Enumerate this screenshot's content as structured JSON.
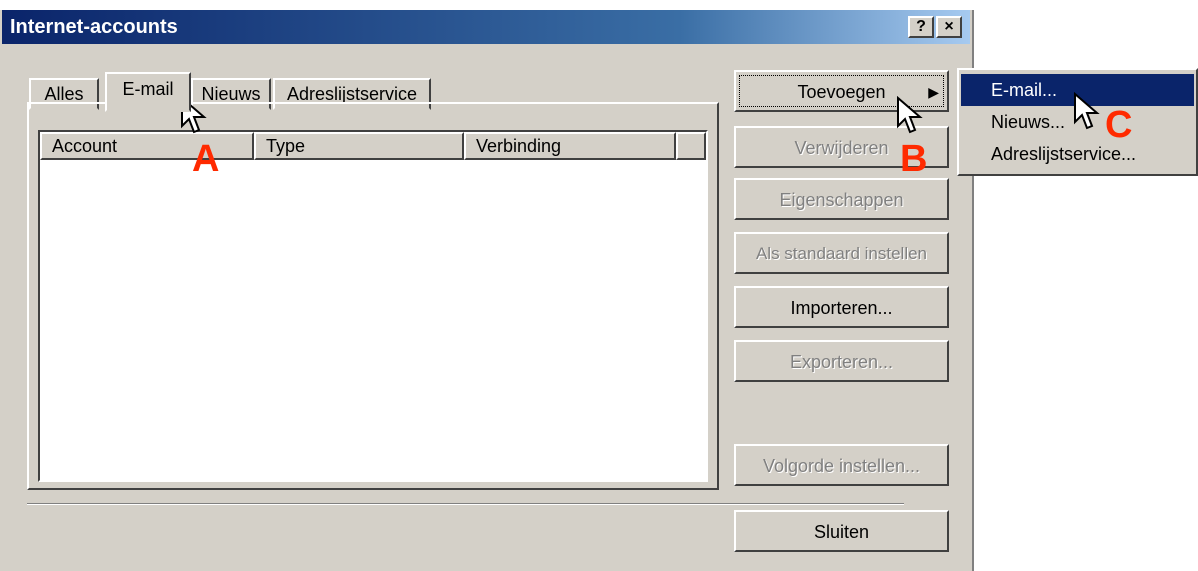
{
  "window": {
    "title": "Internet-accounts",
    "help_btn": "?",
    "close_btn": "×"
  },
  "tabs": [
    {
      "label": "Alles"
    },
    {
      "label": "E-mail"
    },
    {
      "label": "Nieuws"
    },
    {
      "label": "Adreslijstservice"
    }
  ],
  "list": {
    "columns": [
      "Account",
      "Type",
      "Verbinding"
    ],
    "rows": []
  },
  "buttons": {
    "toevoegen": "Toevoegen",
    "toevoegen_arrow": "▶",
    "verwijderen": "Verwijderen",
    "eigenschappen": "Eigenschappen",
    "standaard": "Als standaard instellen",
    "importeren": "Importeren...",
    "exporteren": "Exporteren...",
    "volgorde": "Volgorde instellen...",
    "sluiten": "Sluiten"
  },
  "submenu": {
    "items": [
      "E-mail...",
      "Nieuws...",
      "Adreslijstservice..."
    ],
    "selected": "E-mail..."
  },
  "annotations": {
    "a": "A",
    "b": "B",
    "c": "C"
  },
  "colors": {
    "title_start": "#0a246a",
    "title_end": "#a6caf0",
    "face": "#d4d0c8",
    "annotation": "#ff2a00",
    "menu_highlight": "#0a246a"
  }
}
